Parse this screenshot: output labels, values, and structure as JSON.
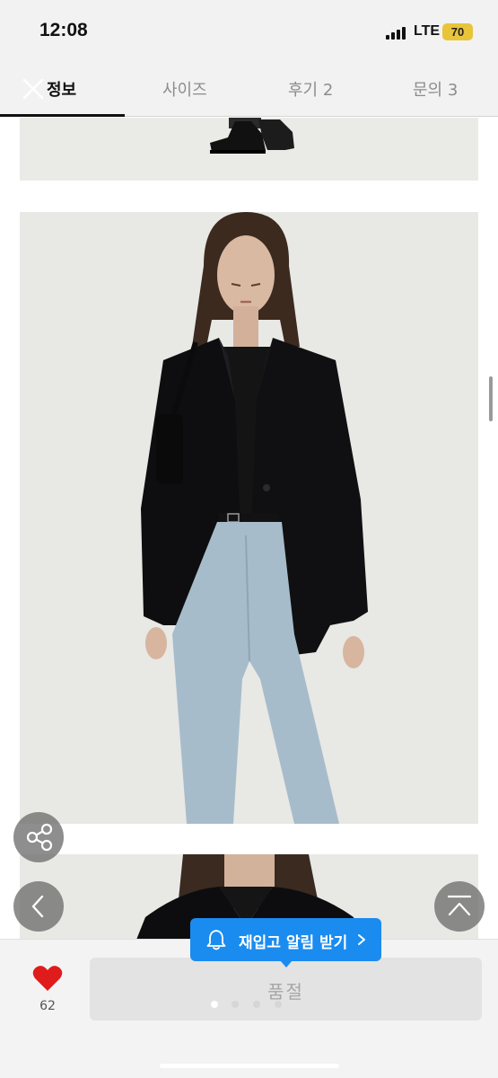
{
  "status_bar": {
    "time": "12:08",
    "network": "LTE",
    "battery": "70"
  },
  "tabs": [
    {
      "label": "정보",
      "active": true
    },
    {
      "label": "사이즈",
      "active": false
    },
    {
      "label": "후기 2",
      "active": false
    },
    {
      "label": "문의 3",
      "active": false
    }
  ],
  "product_images": [
    {
      "icon": "photo-boots-crop"
    },
    {
      "icon": "photo-model-black-blazer-jeans"
    },
    {
      "icon": "photo-model-closeup"
    }
  ],
  "floating_buttons": {
    "share_icon": "share-icon",
    "back_icon": "chevron-left-icon",
    "top_icon": "scroll-to-top-icon"
  },
  "restock": {
    "label": "재입고 알림 받기",
    "icon": "bell-icon"
  },
  "bottom_bar": {
    "like_count": "62",
    "button_label": "품절"
  },
  "colors": {
    "accent_blue": "#1a8cf0",
    "heart_red": "#e01b1b",
    "soldout_bg": "#e3e3e3"
  }
}
